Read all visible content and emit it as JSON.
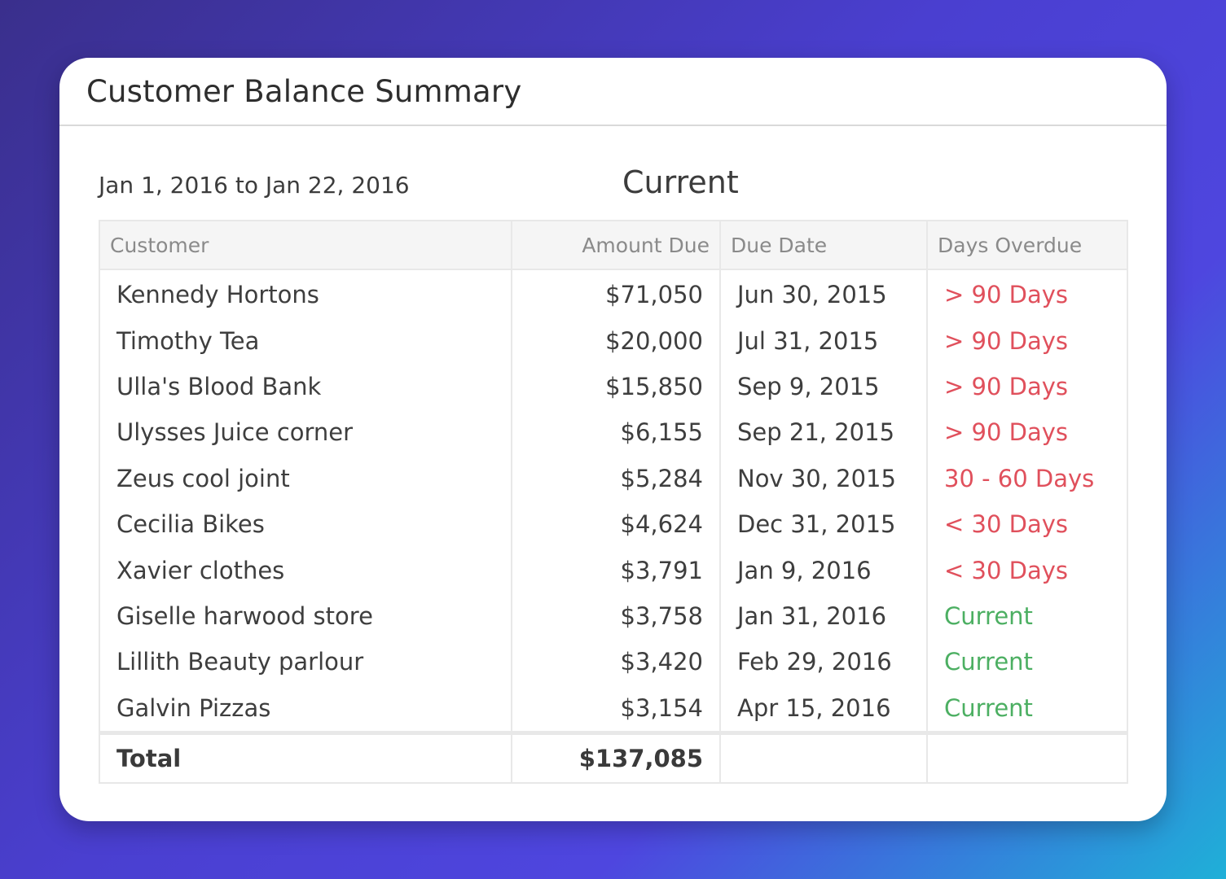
{
  "card": {
    "title": "Customer Balance Summary"
  },
  "meta": {
    "date_range": "Jan 1, 2016 to Jan 22, 2016",
    "status_heading": "Current"
  },
  "table": {
    "headers": {
      "customer": "Customer",
      "amount_due": "Amount Due",
      "due_date": "Due Date",
      "days_overdue": "Days Overdue"
    },
    "rows": [
      {
        "customer": "Kennedy Hortons",
        "amount_due": "$71,050",
        "due_date": "Jun 30, 2015",
        "days_overdue": "> 90 Days",
        "status_color": "#e0505c"
      },
      {
        "customer": "Timothy Tea",
        "amount_due": "$20,000",
        "due_date": "Jul 31, 2015",
        "days_overdue": "> 90 Days",
        "status_color": "#e0505c"
      },
      {
        "customer": "Ulla's Blood Bank",
        "amount_due": "$15,850",
        "due_date": "Sep 9, 2015",
        "days_overdue": "> 90 Days",
        "status_color": "#e0505c"
      },
      {
        "customer": "Ulysses Juice corner",
        "amount_due": "$6,155",
        "due_date": "Sep 21, 2015",
        "days_overdue": "> 90 Days",
        "status_color": "#e0505c"
      },
      {
        "customer": "Zeus cool joint",
        "amount_due": "$5,284",
        "due_date": "Nov 30, 2015",
        "days_overdue": "30 - 60 Days",
        "status_color": "#e0505c"
      },
      {
        "customer": "Cecilia Bikes",
        "amount_due": "$4,624",
        "due_date": "Dec 31, 2015",
        "days_overdue": "< 30 Days",
        "status_color": "#e0505c"
      },
      {
        "customer": "Xavier clothes",
        "amount_due": "$3,791",
        "due_date": "Jan 9, 2016",
        "days_overdue": "< 30 Days",
        "status_color": "#e0505c"
      },
      {
        "customer": "Giselle harwood store",
        "amount_due": "$3,758",
        "due_date": "Jan 31, 2016",
        "days_overdue": "Current",
        "status_color": "#4caf62"
      },
      {
        "customer": "Lillith Beauty parlour",
        "amount_due": "$3,420",
        "due_date": "Feb 29, 2016",
        "days_overdue": "Current",
        "status_color": "#4caf62"
      },
      {
        "customer": "Galvin Pizzas",
        "amount_due": "$3,154",
        "due_date": "Apr 15, 2016",
        "days_overdue": "Current",
        "status_color": "#4caf62"
      }
    ],
    "total": {
      "label": "Total",
      "amount_due": "$137,085"
    }
  }
}
